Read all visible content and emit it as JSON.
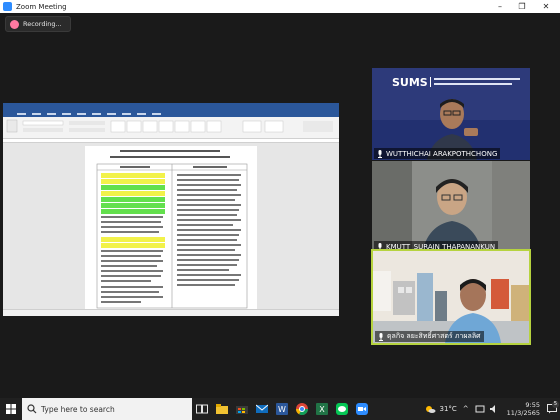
{
  "window": {
    "title": "Zoom Meeting",
    "controls": {
      "minimize": "–",
      "maximize": "❐",
      "close": "✕"
    }
  },
  "recording": {
    "label": "Recording...",
    "dot_color": "#ff7aa2"
  },
  "participants": [
    {
      "name": "WUTTHICHAI ARAKPOTHCHONG"
    },
    {
      "name": "KMUTT_SURAIN THAPANANKUN"
    },
    {
      "name": "ดุลกิจ ลยะสิทธิ์ศาสตร์ ภาผลลิศ",
      "active_speaker": true
    }
  ],
  "branding": {
    "logo_text": "SUMS"
  },
  "taskbar": {
    "search_placeholder": "Type here to search",
    "apps": [
      "task-view",
      "file-explorer",
      "store",
      "mail",
      "word",
      "chrome",
      "excel",
      "line",
      "zoom"
    ],
    "weather": "31°C",
    "time": "9:55",
    "date": "11/3/2565",
    "notifications": "5"
  },
  "colors": {
    "zoom_blue": "#2d8cff",
    "word_blue": "#2b579a",
    "active_border": "#b6d33f",
    "taskbar": "#202020"
  }
}
